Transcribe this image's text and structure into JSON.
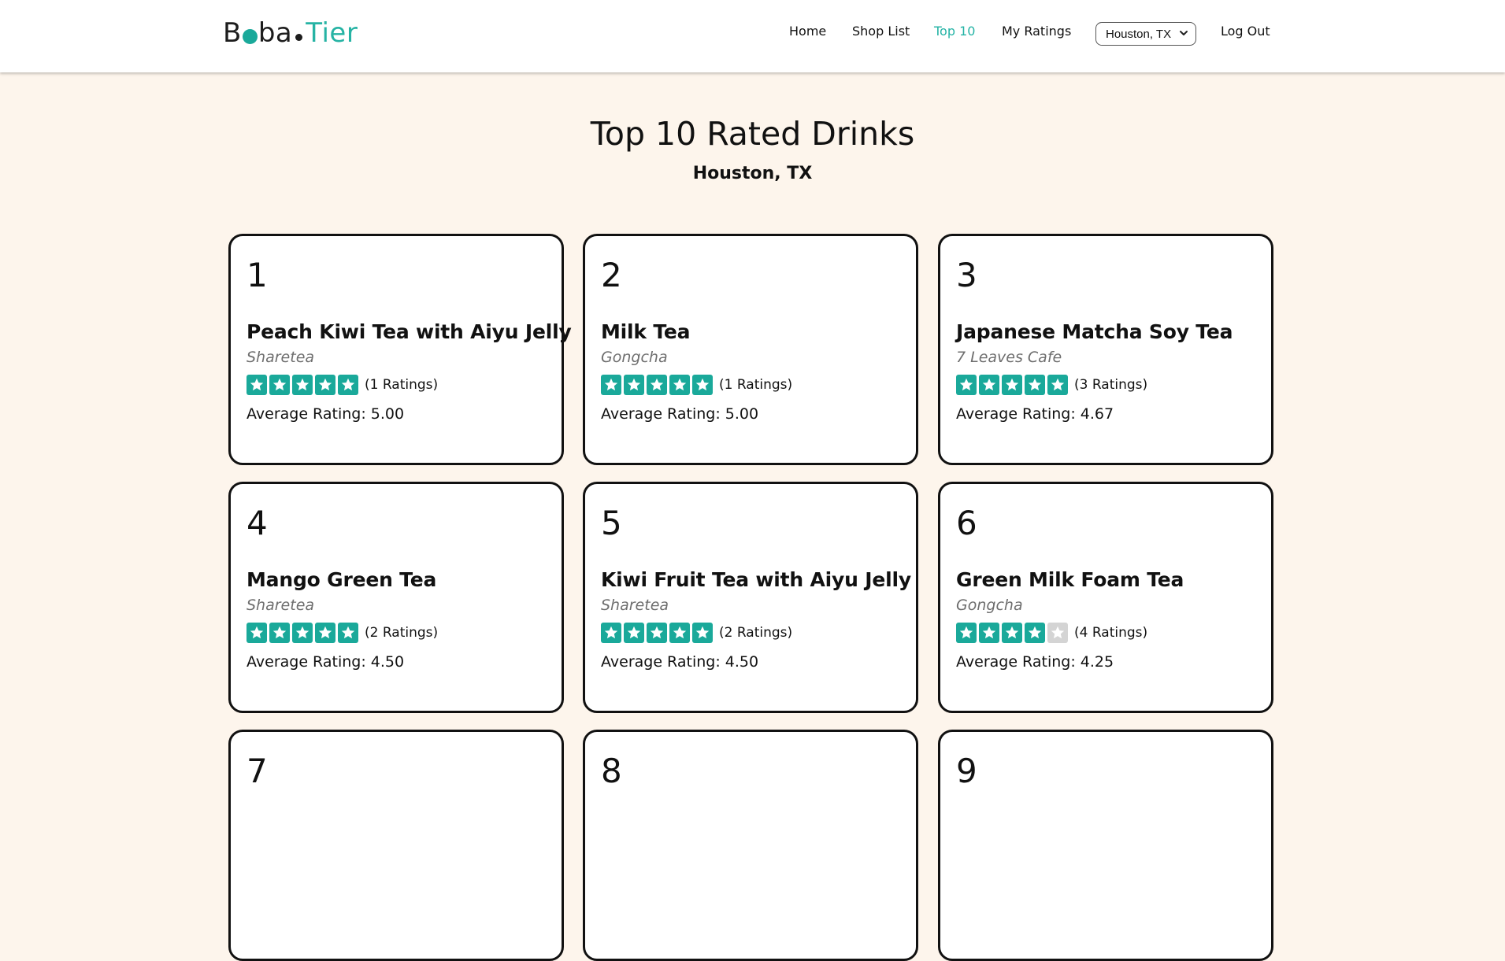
{
  "brand": {
    "part1": "B",
    "part2": "ba",
    "part3": "Tier"
  },
  "nav": {
    "home": "Home",
    "shop_list": "Shop List",
    "top10": "Top 10",
    "my_ratings": "My Ratings",
    "city_selected": "Houston, TX",
    "logout": "Log Out"
  },
  "colors": {
    "accent": "#26b3a4",
    "star_on": "#1aa99a",
    "star_off": "#d4d4d4",
    "background": "#fdf5ec"
  },
  "page": {
    "title": "Top 10 Rated Drinks",
    "subtitle": "Houston, TX"
  },
  "drinks": [
    {
      "rank": "1",
      "name": "Peach Kiwi Tea with Aiyu Jelly",
      "shop": "Sharetea",
      "stars": 5,
      "count_text": "(1 Ratings)",
      "avg_text": "Average Rating: 5.00"
    },
    {
      "rank": "2",
      "name": "Milk Tea",
      "shop": "Gongcha",
      "stars": 5,
      "count_text": "(1 Ratings)",
      "avg_text": "Average Rating: 5.00"
    },
    {
      "rank": "3",
      "name": "Japanese Matcha Soy Tea",
      "shop": "7 Leaves Cafe",
      "stars": 5,
      "count_text": "(3 Ratings)",
      "avg_text": "Average Rating: 4.67"
    },
    {
      "rank": "4",
      "name": "Mango Green Tea",
      "shop": "Sharetea",
      "stars": 5,
      "count_text": "(2 Ratings)",
      "avg_text": "Average Rating: 4.50"
    },
    {
      "rank": "5",
      "name": "Kiwi Fruit Tea with Aiyu Jelly",
      "shop": "Sharetea",
      "stars": 5,
      "count_text": "(2 Ratings)",
      "avg_text": "Average Rating: 4.50"
    },
    {
      "rank": "6",
      "name": "Green Milk Foam Tea",
      "shop": "Gongcha",
      "stars": 4,
      "count_text": "(4 Ratings)",
      "avg_text": "Average Rating: 4.25"
    },
    {
      "rank": "7"
    },
    {
      "rank": "8"
    },
    {
      "rank": "9"
    }
  ]
}
